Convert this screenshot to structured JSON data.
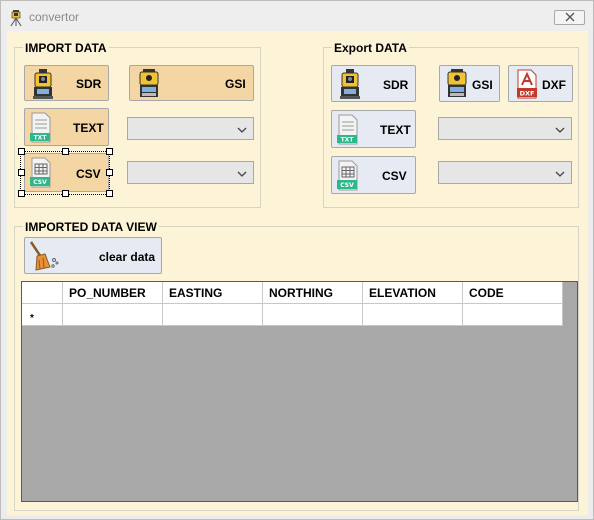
{
  "window": {
    "title": "convertor"
  },
  "import_group": {
    "title": "IMPORT DATA",
    "sdr_label": "SDR",
    "gsi_label": "GSI",
    "text_label": "TEXT",
    "csv_label": "CSV",
    "combo1_value": "",
    "combo2_value": ""
  },
  "export_group": {
    "title": "Export DATA",
    "sdr_label": "SDR",
    "gsi_label": "GSI",
    "dxf_label": "DXF",
    "text_label": "TEXT",
    "csv_label": "CSV",
    "combo1_value": "",
    "combo2_value": ""
  },
  "view_group": {
    "title": "IMPORTED DATA VIEW",
    "clear_label": "clear data"
  },
  "table": {
    "columns": [
      "PO_NUMBER",
      "EASTING",
      "NORTHING",
      "ELEVATION",
      "CODE"
    ],
    "new_row_marker": "*"
  },
  "icons": {
    "total_station": "total-station-icon",
    "txt_file": "txt-file-icon",
    "csv_file": "csv-file-icon",
    "dxf_file": "dxf-file-icon",
    "broom": "broom-icon"
  },
  "colors": {
    "client_bg": "#fdf4d8",
    "tan_button": "#f4d6a4",
    "light_button": "#e6ebf3",
    "grid_bg": "#a8a8a8"
  }
}
